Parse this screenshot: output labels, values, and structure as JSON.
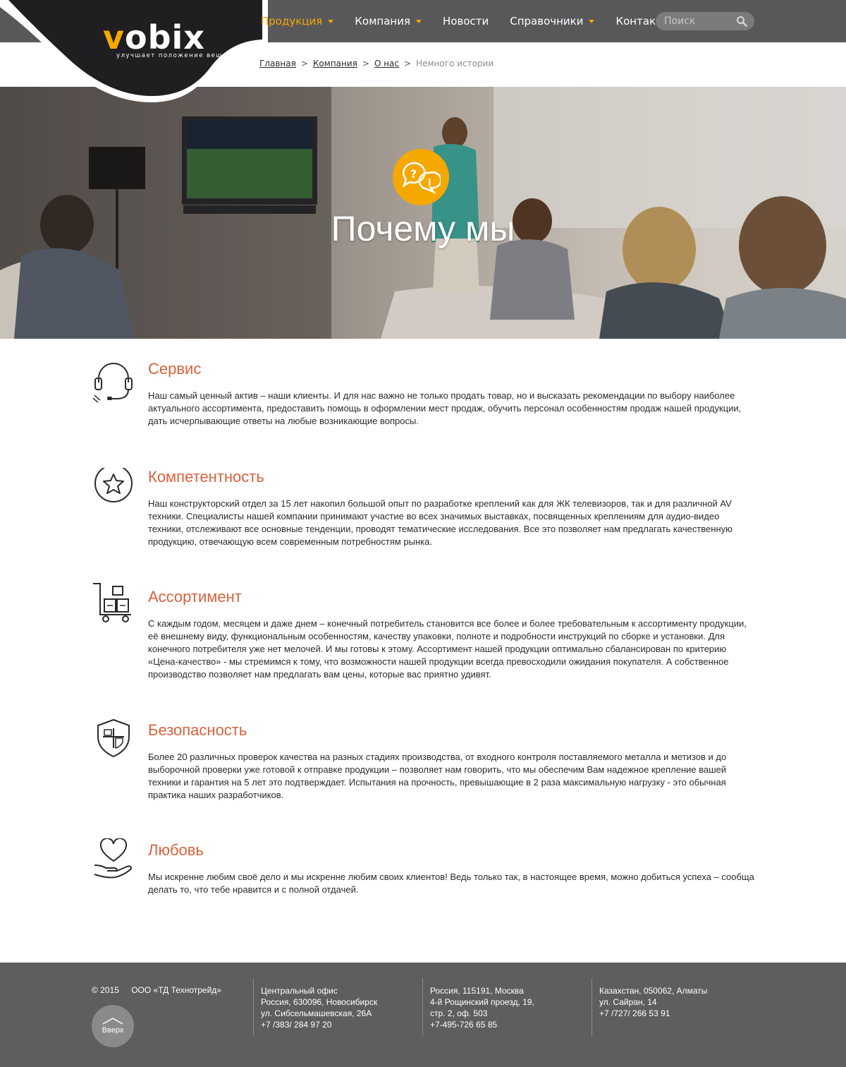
{
  "brand": {
    "name_prefix": "v",
    "name_rest": "obix",
    "tagline": "улучшает положение вещей"
  },
  "nav": {
    "items": [
      {
        "label": "Продукция",
        "has_dropdown": true,
        "active": true
      },
      {
        "label": "Компания",
        "has_dropdown": true,
        "active": false
      },
      {
        "label": "Новости",
        "has_dropdown": false,
        "active": false
      },
      {
        "label": "Справочники",
        "has_dropdown": true,
        "active": false
      },
      {
        "label": "Контакты",
        "has_dropdown": true,
        "active": false
      }
    ]
  },
  "search": {
    "placeholder": "Поиск",
    "icon": "search-icon"
  },
  "breadcrumb": {
    "links": [
      "Главная",
      "Компания",
      "О нас"
    ],
    "separator": ">",
    "current": "Немного истории"
  },
  "hero": {
    "title": "Почему мы",
    "badge_icon": "question-info-bubbles-icon"
  },
  "features": [
    {
      "icon": "headset-icon",
      "title": "Сервис",
      "text": "Наш самый ценный актив – наши клиенты. И для нас важно не только продать товар, но и высказать рекомендации по выбору наиболее актуального ассортимента, предоставить помощь в оформлении мест продаж, обучить персонал особенностям продаж нашей продукции, дать исчерпывающие ответы на любые возникающие вопросы."
    },
    {
      "icon": "star-circle-icon",
      "title": "Компетентность",
      "text": "Наш конструкторский отдел за 15 лет накопил большой опыт по разработке креплений как для ЖК телевизоров, так и для различной AV техники. Специалисты нашей компании принимают участие во всех значимых выставках, посвященных креплениям для аудио-видео техники, отслеживают все основные тенденции, проводят тематические исследования. Все это позволяет нам предлагать качественную продукцию, отвечающую всем современным потребностям рынка."
    },
    {
      "icon": "boxes-cart-icon",
      "title": "Ассортимент",
      "text": "С каждым годом, месяцем и даже днем – конечный потребитель становится все более и более требовательным к ассортименту продукции, её внешнему виду, функциональным особенностям, качеству упаковки, полноте и подробности инструкций по сборке и установки. Для конечного потребителя уже нет мелочей. И мы готовы к этому. Ассортимент нашей продукции оптимально сбалансирован по критерию «Цена-качество» - мы стремимся к тому, что возможности нашей продукции всегда превосходили ожидания покупателя. А собственное производство позволяет нам предлагать вам цены, которые вас приятно удивят."
    },
    {
      "icon": "shield-icon",
      "title": "Безопасность",
      "text": "Более 20 различных проверок качества на разных стадиях производства, от входного контроля поставляемого металла и метизов и до выборочной проверки уже готовой к отправке продукции – позволяет нам говорить, что мы обеспечим Вам надежное крепление вашей техники и гарантия на 5 лет это подтверждает. Испытания на прочность, превышающие в 2 раза максимальную нагрузку - это обычная практика наших разработчиков."
    },
    {
      "icon": "heart-hand-icon",
      "title": "Любовь",
      "text": "Мы искренне любим своё дело и мы искренне любим своих клиентов! Ведь только так, в настоящее время, можно добиться успеха – сообща делать то, что тебе нравится и с полной отдачей."
    }
  ],
  "footer": {
    "year": "© 2015",
    "company": "ООО «ТД Технотрейд»",
    "up_label": "Вверх",
    "offices": [
      {
        "lines": [
          "Центральный офис",
          "Россия, 630096, Новосибирск",
          "ул. Сибсельмашевская, 26А",
          "+7 /383/ 284 97 20"
        ]
      },
      {
        "lines": [
          "Россия, 115191, Москва",
          "4-й Рощинский проезд, 19,",
          "стр. 2, оф. 503",
          "+7-495-726 65 85"
        ]
      },
      {
        "lines": [
          "Казахстан, 050062, Алматы",
          "ул. Сайран, 14",
          "+7 /727/ 266 53 91"
        ]
      }
    ]
  },
  "colors": {
    "accent": "#f5a800",
    "heading": "#d9623d",
    "header_bg": "#58585a",
    "footer_bg": "#5e5e60"
  }
}
